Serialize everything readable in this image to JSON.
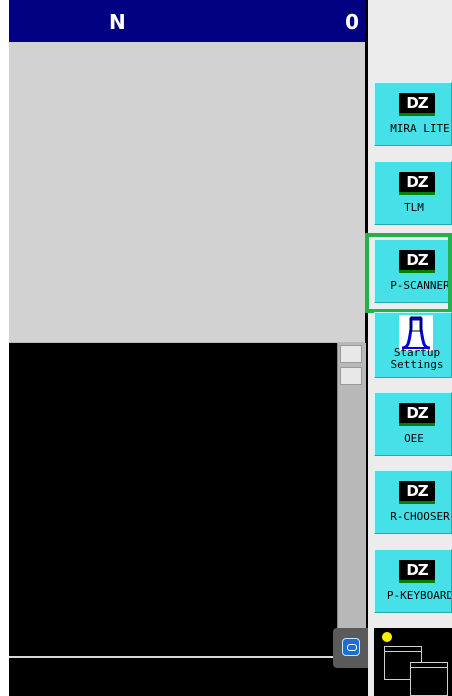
{
  "titlebar": {
    "left_text": "N",
    "right_text": "0"
  },
  "launcher": {
    "items": [
      {
        "label": "MIRA LITE",
        "logo": "DZ",
        "icon": "dz-logo-icon"
      },
      {
        "label": "TLM",
        "logo": "DZ",
        "icon": "dz-logo-icon"
      },
      {
        "label": "P-SCANNER",
        "logo": "DZ",
        "icon": "dz-logo-icon",
        "selected": true
      },
      {
        "label": "Startup Settings",
        "icon": "startup-settings-icon"
      },
      {
        "label": "OEE",
        "logo": "DZ",
        "icon": "dz-logo-icon"
      },
      {
        "label": "R-CHOOSER",
        "logo": "DZ",
        "icon": "dz-logo-icon"
      },
      {
        "label": "P-KEYBOARD",
        "logo": "DZ",
        "icon": "dz-logo-icon"
      }
    ]
  },
  "colors": {
    "titlebar": "#000080",
    "tile": "#46e0e8",
    "selection": "#22b24d",
    "console": "#000000",
    "panel": "#d2d2d2"
  },
  "tray": {
    "indicator_color": "#ffee00",
    "icon": "windows-icon"
  }
}
